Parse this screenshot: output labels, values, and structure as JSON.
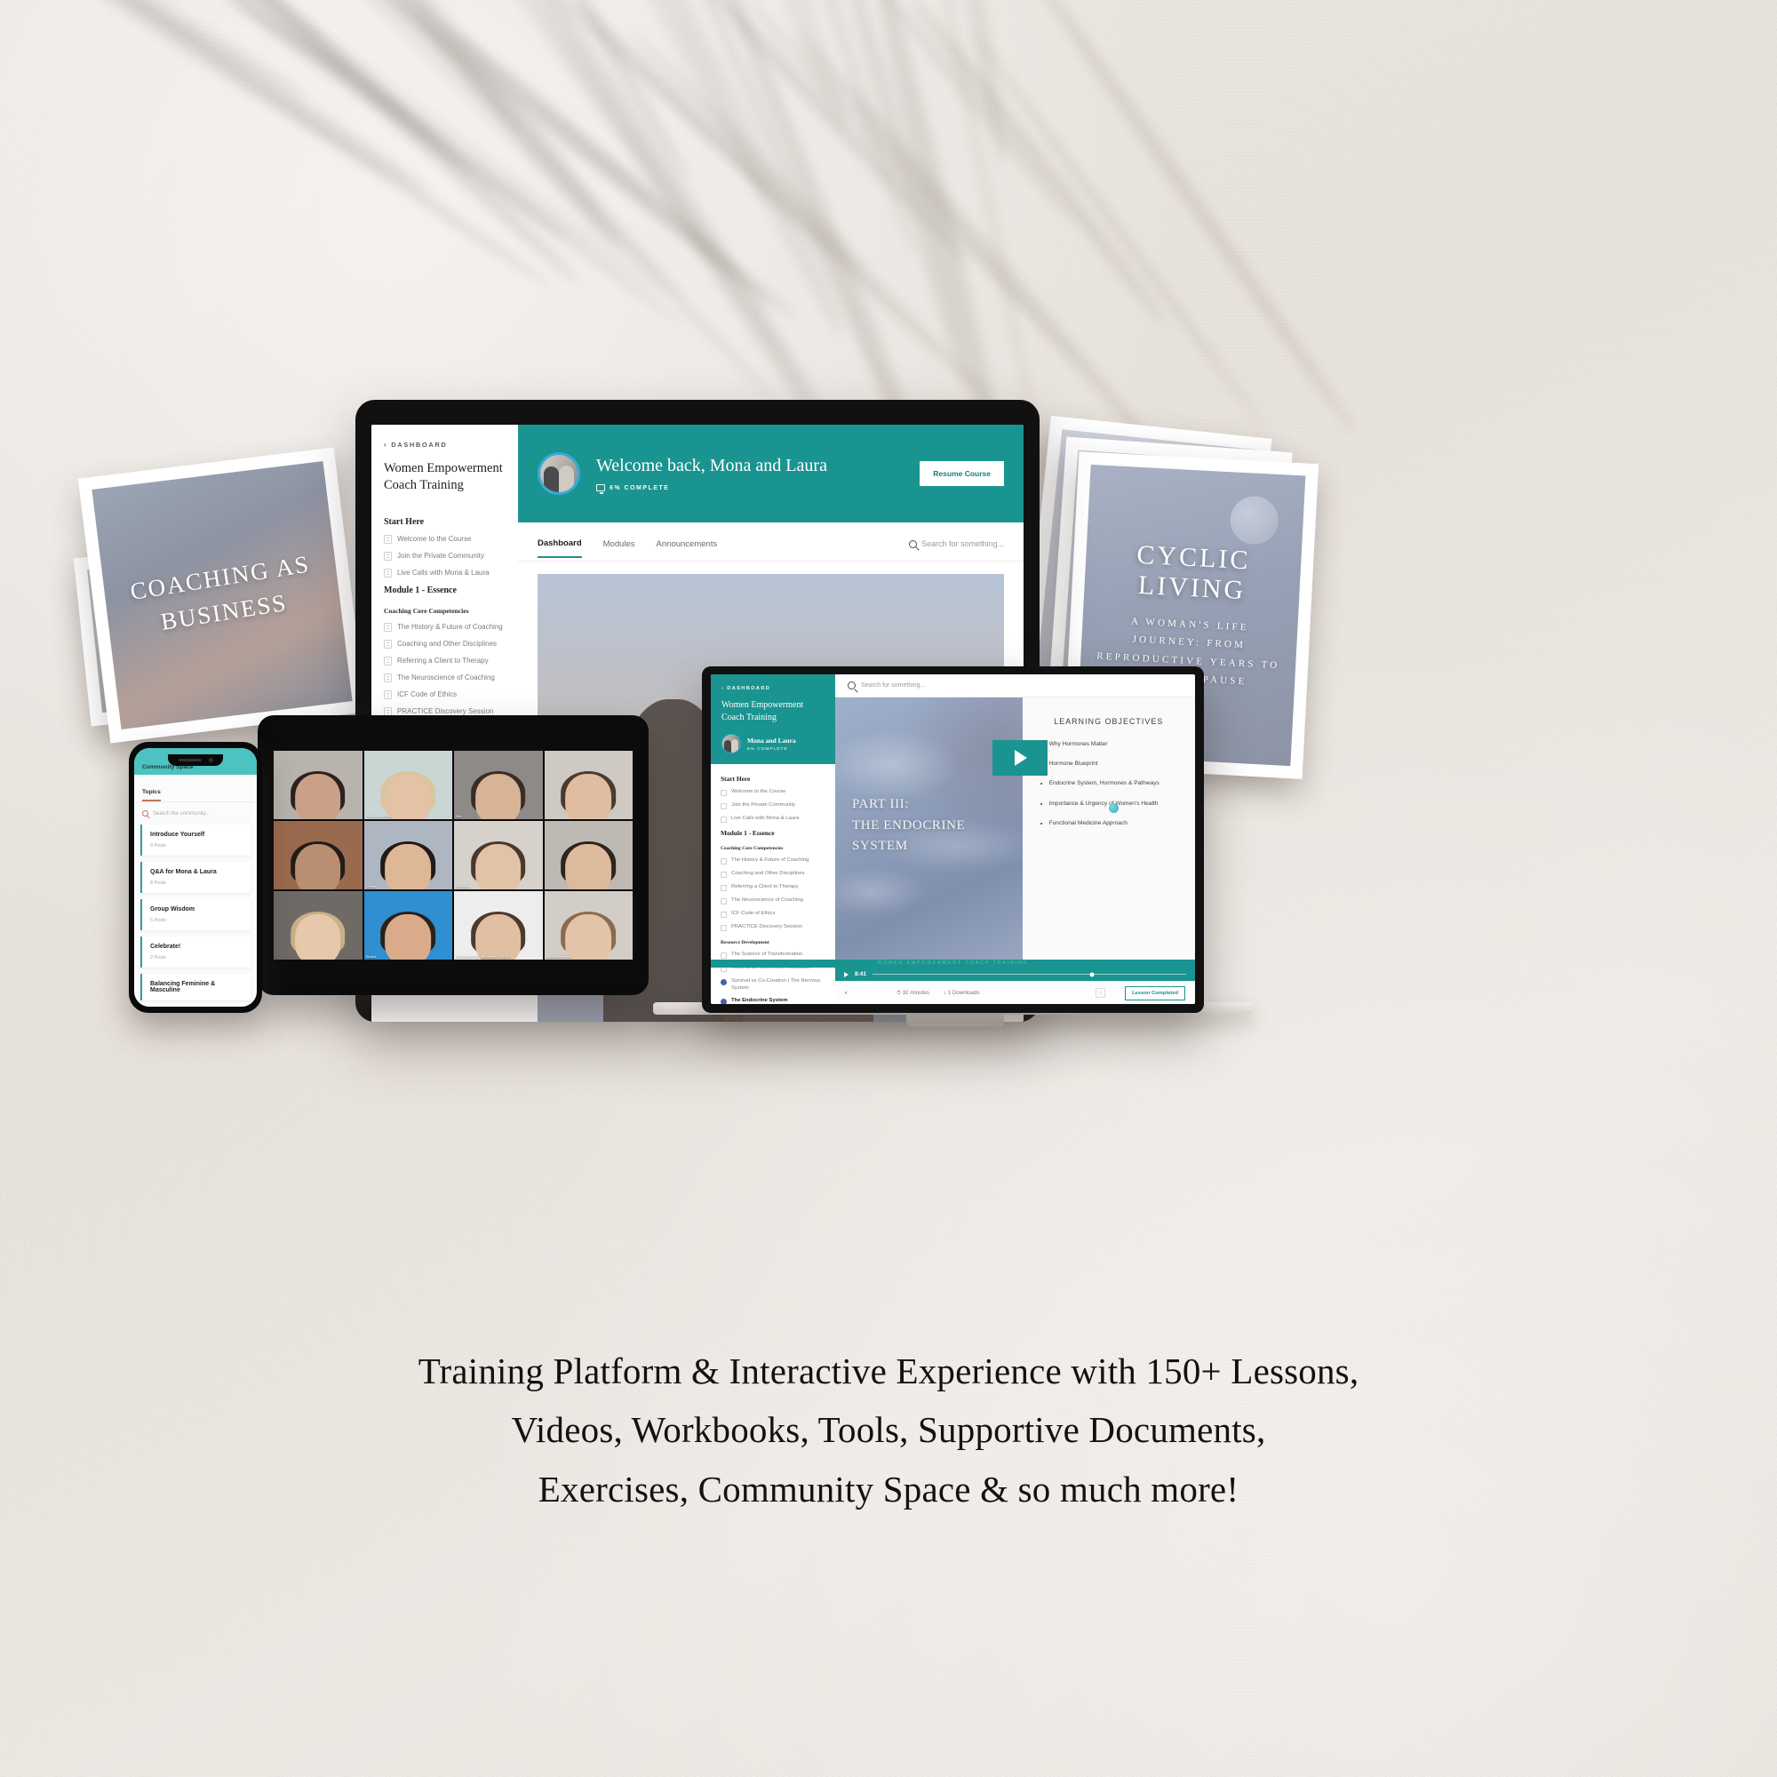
{
  "brand": {
    "teal": "#1a9490",
    "teal_light": "#4cc3c1",
    "accent_blue": "#3aa9d4",
    "ink": "#1d1d1d"
  },
  "caption": {
    "line1": "Training Platform & Interactive Experience with 150+ Lessons,",
    "line2": "Videos, Workbooks, Tools, Supportive Documents,",
    "line3": "Exercises, Community Space & so much more!"
  },
  "prints": {
    "left": {
      "title_line1": "COACHING AS",
      "title_line2": "BUSINESS"
    },
    "right": {
      "title": "CYCLIC LIVING",
      "subtitle": "A WOMAN'S LIFE JOURNEY: FROM REPRODUCTIVE YEARS TO POSTMENOPAUSE"
    }
  },
  "laptop": {
    "breadcrumb": "DASHBOARD",
    "breadcrumb_chevron": "‹",
    "course_title": "Women Empowerment Coach Training",
    "banner": {
      "greeting": "Welcome back, Mona and Laura",
      "progress": "6% COMPLETE",
      "resume_label": "Resume Course"
    },
    "tabs": [
      {
        "label": "Dashboard",
        "active": true
      },
      {
        "label": "Modules",
        "active": false
      },
      {
        "label": "Announcements",
        "active": false
      }
    ],
    "search_placeholder": "Search for something...",
    "sidebar": [
      {
        "heading": "Start Here",
        "level": "section"
      },
      {
        "label": "Welcome to the Course",
        "icon": "document-icon",
        "state": "todo"
      },
      {
        "label": "Join the Private Community",
        "icon": "document-icon",
        "state": "todo"
      },
      {
        "label": "Live Calls with Mona & Laura",
        "icon": "document-icon",
        "state": "todo"
      },
      {
        "heading": "Module 1 - Essence",
        "level": "section"
      },
      {
        "heading": "Coaching Core Competencies",
        "level": "sub"
      },
      {
        "label": "The History & Future of Coaching",
        "icon": "assignment-icon",
        "state": "todo"
      },
      {
        "label": "Coaching and Other Disciplines",
        "icon": "document-icon",
        "state": "todo"
      },
      {
        "label": "Referring a Client to Therapy",
        "icon": "document-icon",
        "state": "todo"
      },
      {
        "label": "The Neuroscience of Coaching",
        "icon": "document-icon",
        "state": "todo"
      },
      {
        "label": "ICF Code of Ethics",
        "icon": "document-icon",
        "state": "todo"
      },
      {
        "label": "PRACTICE Discovery Session",
        "icon": "assignment-icon",
        "state": "todo"
      },
      {
        "heading": "Resource Development",
        "level": "sub"
      },
      {
        "label": "The Science of Transformation",
        "icon": "document-icon",
        "state": "todo"
      }
    ]
  },
  "desktop": {
    "breadcrumb": "DASHBOARD",
    "breadcrumb_chevron": "‹",
    "course_title": "Women Empowerment Coach Training",
    "user_name": "Mona and Laura",
    "user_progress": "6% COMPLETE",
    "search_placeholder": "Search for something...",
    "sidebar": [
      {
        "heading": "Start Here",
        "level": "section"
      },
      {
        "label": "Welcome to the Course",
        "icon": "document-icon",
        "state": "todo"
      },
      {
        "label": "Join the Private Community",
        "icon": "document-icon",
        "state": "todo"
      },
      {
        "label": "Live Calls with Mona & Laura",
        "icon": "document-icon",
        "state": "todo"
      },
      {
        "heading": "Module 1 - Essence",
        "level": "section"
      },
      {
        "heading": "Coaching Core Competencies",
        "level": "sub"
      },
      {
        "label": "The History & Future of Coaching",
        "icon": "assignment-icon",
        "state": "todo"
      },
      {
        "label": "Coaching and Other Disciplines",
        "icon": "document-icon",
        "state": "todo"
      },
      {
        "label": "Referring a Client to Therapy",
        "icon": "document-icon",
        "state": "todo"
      },
      {
        "label": "The Neuroscience of Coaching",
        "icon": "document-icon",
        "state": "todo"
      },
      {
        "label": "ICF Code of Ethics",
        "icon": "document-icon",
        "state": "todo"
      },
      {
        "label": "PRACTICE Discovery Session",
        "icon": "assignment-icon",
        "state": "todo"
      },
      {
        "heading": "Resource Development",
        "level": "sub"
      },
      {
        "label": "The Science of Transformation",
        "icon": "document-icon",
        "state": "todo"
      },
      {
        "label": "Heart-Brain Coherence Meditation",
        "icon": "assignment-icon",
        "state": "todo"
      },
      {
        "label": "Survival vs Co-Creation | The Nervous System",
        "icon": "video-icon",
        "state": "done"
      },
      {
        "label": "The Endocrine System",
        "icon": "video-icon",
        "state": "current"
      }
    ],
    "slide": {
      "line1": "PART III:",
      "line2": "THE ENDOCRINE",
      "line3": "SYSTEM"
    },
    "objectives": {
      "heading": "LEARNING OBJECTIVES",
      "items": [
        "Why Hormones Matter",
        "Hormone Blueprint",
        "Endocrine System, Hormones & Pathways",
        "Importance & Urgency of Women's Health",
        "Functional Medicine Approach"
      ]
    },
    "player": {
      "current_time": "8:41",
      "banner_text": "WOMEN EMPOWERMENT COACH TRAINING"
    },
    "footer": {
      "back_chevron": "‹",
      "duration": "32 minutes",
      "downloads": "1 Downloads",
      "complete_label": "Lesson Completed",
      "star_glyph": "☆"
    }
  },
  "phone": {
    "header_title": "Community Space",
    "tab_label": "Topics",
    "search_placeholder": "Search the community...",
    "topics": [
      {
        "title": "Introduce Yourself",
        "posts": "9 Posts"
      },
      {
        "title": "Q&A for Mona & Laura",
        "posts": "8 Posts"
      },
      {
        "title": "Group Wisdom",
        "posts": "5 Posts"
      },
      {
        "title": "Celebrate!",
        "posts": "2 Posts"
      },
      {
        "title": "Balancing Feminine & Masculine",
        "posts": ""
      }
    ]
  },
  "tablet": {
    "call_participants": [
      {
        "name": "",
        "skin": "#caa188",
        "hair": "#2b2220",
        "bg": "#b9b3ad"
      },
      {
        "name": "Laura van de Werd",
        "skin": "#e3c2a6",
        "hair": "#d8c79e",
        "bg": "#c9d6d4"
      },
      {
        "name": "Info",
        "skin": "#d8b396",
        "hair": "#3a2c26",
        "bg": "#8d8a88"
      },
      {
        "name": "",
        "skin": "#e0bda0",
        "hair": "#4a3a30",
        "bg": "#cfc9c3"
      },
      {
        "name": "",
        "skin": "#b98e73",
        "hair": "#241c19",
        "bg": "#9a6a4e"
      },
      {
        "name": "Alessia",
        "skin": "#ddb796",
        "hair": "#211a17",
        "bg": "#aeb6c2"
      },
      {
        "name": "Francesca",
        "skin": "#e2c3a7",
        "hair": "#4b382d",
        "bg": "#d6d1cb"
      },
      {
        "name": "",
        "skin": "#dcbb9d",
        "hair": "#2e2420",
        "bg": "#bfb9b3"
      },
      {
        "name": "",
        "skin": "#e6c8ab",
        "hair": "#c9b086",
        "bg": "#6f6a66"
      },
      {
        "name": "Monika",
        "skin": "#d9ab8b",
        "hair": "#2a211d",
        "bg": "#2f8fd0"
      },
      {
        "name": "KUTSCHER-SALIBA Miriam (VCA-NL)",
        "skin": "#e0bfa2",
        "hair": "#4b3a2e",
        "bg": "#ededed"
      },
      {
        "name": "Nadine Bergmann",
        "skin": "#e3c4a8",
        "hair": "#8a6b4e",
        "bg": "#d3cdc7"
      }
    ]
  }
}
